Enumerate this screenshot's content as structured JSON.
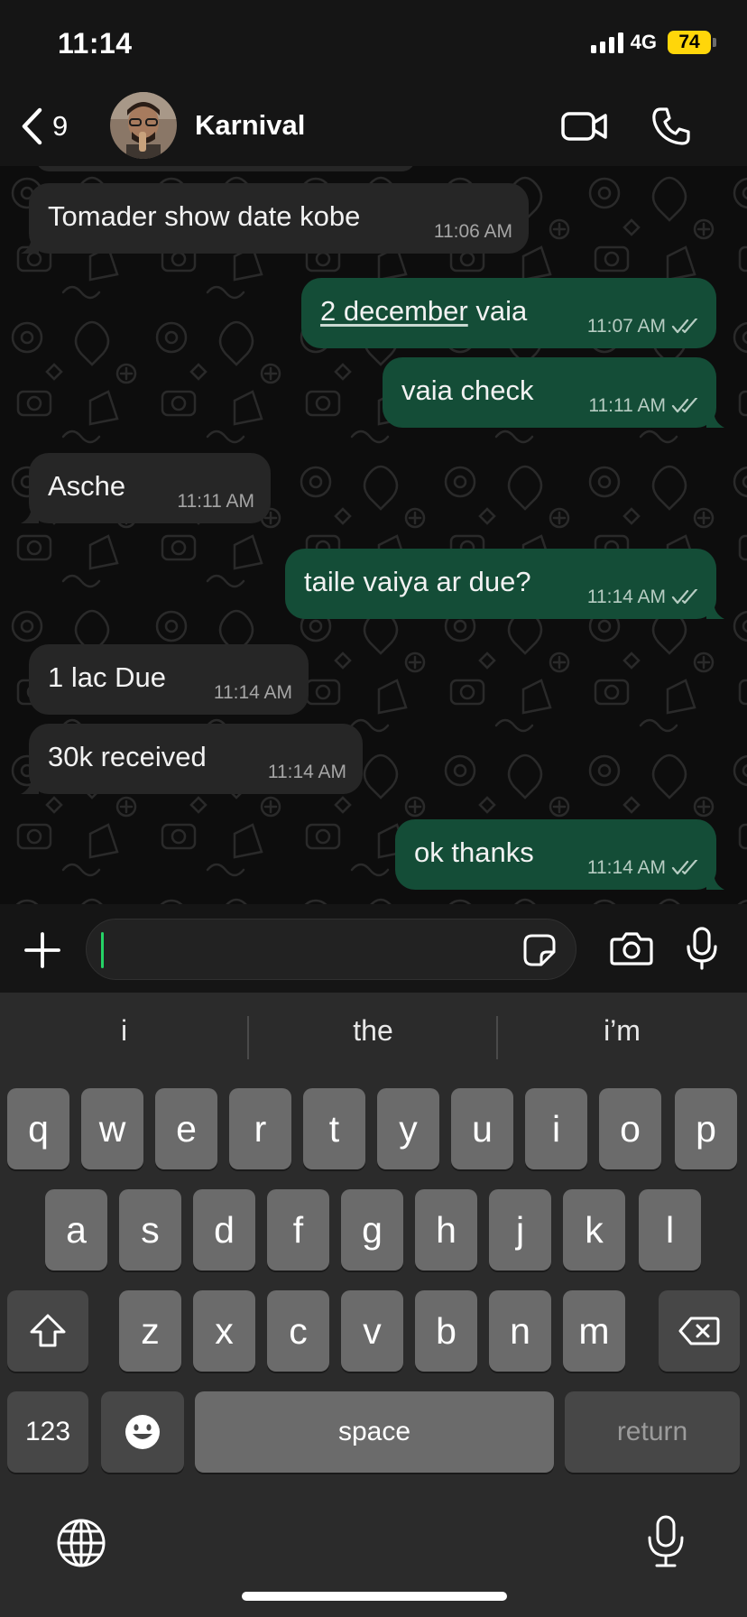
{
  "status_bar": {
    "time": "11:14",
    "network": "4G",
    "battery": "74"
  },
  "header": {
    "back_count": "9",
    "contact_name": "Karnival"
  },
  "messages": [
    {
      "dir": "in",
      "text": "Tomader show date kobe",
      "time": "11:06 AM"
    },
    {
      "dir": "out",
      "text_link": "2 december",
      "text_rest": " vaia",
      "time": "11:07 AM",
      "status": "read"
    },
    {
      "dir": "out",
      "text": "vaia check",
      "time": "11:11 AM",
      "status": "read"
    },
    {
      "dir": "in",
      "text": "Asche",
      "time": "11:11 AM"
    },
    {
      "dir": "out",
      "text": "taile vaiya ar due?",
      "time": "11:14 AM",
      "status": "read"
    },
    {
      "dir": "in",
      "text": "1 lac Due",
      "time": "11:14 AM"
    },
    {
      "dir": "in",
      "text": "30k received",
      "time": "11:14 AM"
    },
    {
      "dir": "out",
      "text": "ok thanks",
      "time": "11:14 AM",
      "status": "read"
    }
  ],
  "composer": {
    "value": ""
  },
  "keyboard": {
    "suggestions": [
      "i",
      "the",
      "i’m"
    ],
    "row1": [
      "q",
      "w",
      "e",
      "r",
      "t",
      "y",
      "u",
      "i",
      "o",
      "p"
    ],
    "row2": [
      "a",
      "s",
      "d",
      "f",
      "g",
      "h",
      "j",
      "k",
      "l"
    ],
    "row3": [
      "z",
      "x",
      "c",
      "v",
      "b",
      "n",
      "m"
    ],
    "numbers_label": "123",
    "space_label": "space",
    "return_label": "return"
  },
  "colors": {
    "incoming_bubble": "#262626",
    "outgoing_bubble": "#144d37",
    "caret": "#25d366",
    "battery": "#ffd60a"
  }
}
